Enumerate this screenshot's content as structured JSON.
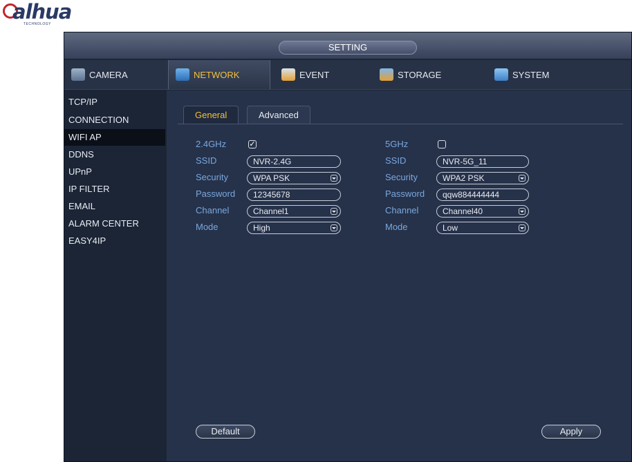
{
  "brand": {
    "logo_text": "alhua",
    "logo_sub": "TECHNOLOGY"
  },
  "window": {
    "title": "SETTING"
  },
  "tabs": [
    {
      "label": "CAMERA",
      "icon": "camera-icon"
    },
    {
      "label": "NETWORK",
      "icon": "network-icon"
    },
    {
      "label": "EVENT",
      "icon": "event-icon"
    },
    {
      "label": "STORAGE",
      "icon": "storage-icon"
    },
    {
      "label": "SYSTEM",
      "icon": "system-icon"
    }
  ],
  "sidebar": {
    "items": [
      "TCP/IP",
      "CONNECTION",
      "WIFI AP",
      "DDNS",
      "UPnP",
      "IP FILTER",
      "EMAIL",
      "ALARM CENTER",
      "EASY4IP"
    ],
    "active": "WIFI AP"
  },
  "subtabs": [
    "General",
    "Advanced"
  ],
  "band24": {
    "band_label": "2.4GHz",
    "enabled": true,
    "ssid_label": "SSID",
    "ssid_value": "NVR-2.4G",
    "security_label": "Security",
    "security_value": "WPA PSK",
    "password_label": "Password",
    "password_value": "12345678",
    "channel_label": "Channel",
    "channel_value": "Channel1",
    "mode_label": "Mode",
    "mode_value": "High"
  },
  "band5": {
    "band_label": "5GHz",
    "enabled": false,
    "ssid_label": "SSID",
    "ssid_value": "NVR-5G_11",
    "security_label": "Security",
    "security_value": "WPA2 PSK",
    "password_label": "Password",
    "password_value": "qqw884444444",
    "channel_label": "Channel",
    "channel_value": "Channel40",
    "mode_label": "Mode",
    "mode_value": "Low"
  },
  "buttons": {
    "default_label": "Default",
    "apply_label": "Apply"
  },
  "colors": {
    "background": "#1b2536",
    "label": "#79a8de",
    "active_tab": "#f3c13a",
    "logo": "#2a3a66",
    "logo_accent": "#c0262d"
  }
}
